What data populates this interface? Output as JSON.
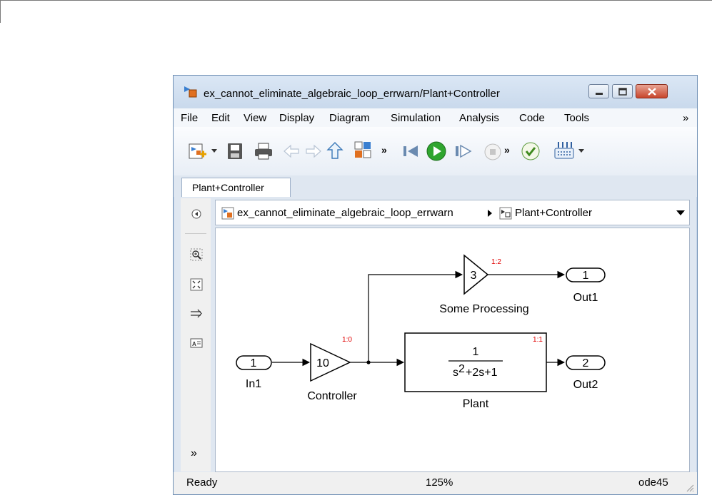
{
  "window": {
    "title": "ex_cannot_eliminate_algebraic_loop_errwarn/Plant+Controller"
  },
  "menu": [
    "File",
    "Edit",
    "View",
    "Display",
    "Diagram",
    "Simulation",
    "Analysis",
    "Code",
    "Tools",
    "»"
  ],
  "toolbar": {
    "icons": [
      "new-model-icon",
      "dropdown-arrow-icon",
      "save-icon",
      "print-icon",
      "back-arrow-icon",
      "forward-arrow-icon",
      "up-arrow-icon",
      "model-explorer-icon",
      "more-icon",
      "step-back-icon",
      "run-icon",
      "step-forward-icon",
      "stop-icon",
      "more-icon",
      "check-icon",
      "library-icon",
      "dropdown-arrow-icon"
    ],
    "overflow_1": "»",
    "overflow_2": "»"
  },
  "tab": {
    "label": "Plant+Controller"
  },
  "breadcrumb": {
    "model": "ex_cannot_eliminate_algebraic_loop_errwarn",
    "subsystem": "Plant+Controller"
  },
  "left_panel": {
    "icons": [
      "hide-browser-icon",
      "zoom-icon",
      "fit-view-icon",
      "arrow-icon",
      "annotation-icon",
      "expand-icon"
    ],
    "expand": "»"
  },
  "diagram": {
    "in1": {
      "port": "1",
      "label": "In1"
    },
    "controller": {
      "gain": "10",
      "label": "Controller",
      "order": "1:0"
    },
    "processing": {
      "gain": "3",
      "label": "Some Processing",
      "order": "1:2"
    },
    "plant": {
      "numerator": "1",
      "denominator_s": "s",
      "denominator_exp": "2",
      "denominator_rest": "+2s+1",
      "label": "Plant",
      "order": "1:1"
    },
    "out1": {
      "port": "1",
      "label": "Out1"
    },
    "out2": {
      "port": "2",
      "label": "Out2"
    }
  },
  "status": {
    "state": "Ready",
    "zoom": "125%",
    "solver": "ode45"
  },
  "colors": {
    "title_bar": "#c9d9ec",
    "close_button": "#c8462c",
    "order_label": "#e00000",
    "run_green": "#2fa52f"
  }
}
